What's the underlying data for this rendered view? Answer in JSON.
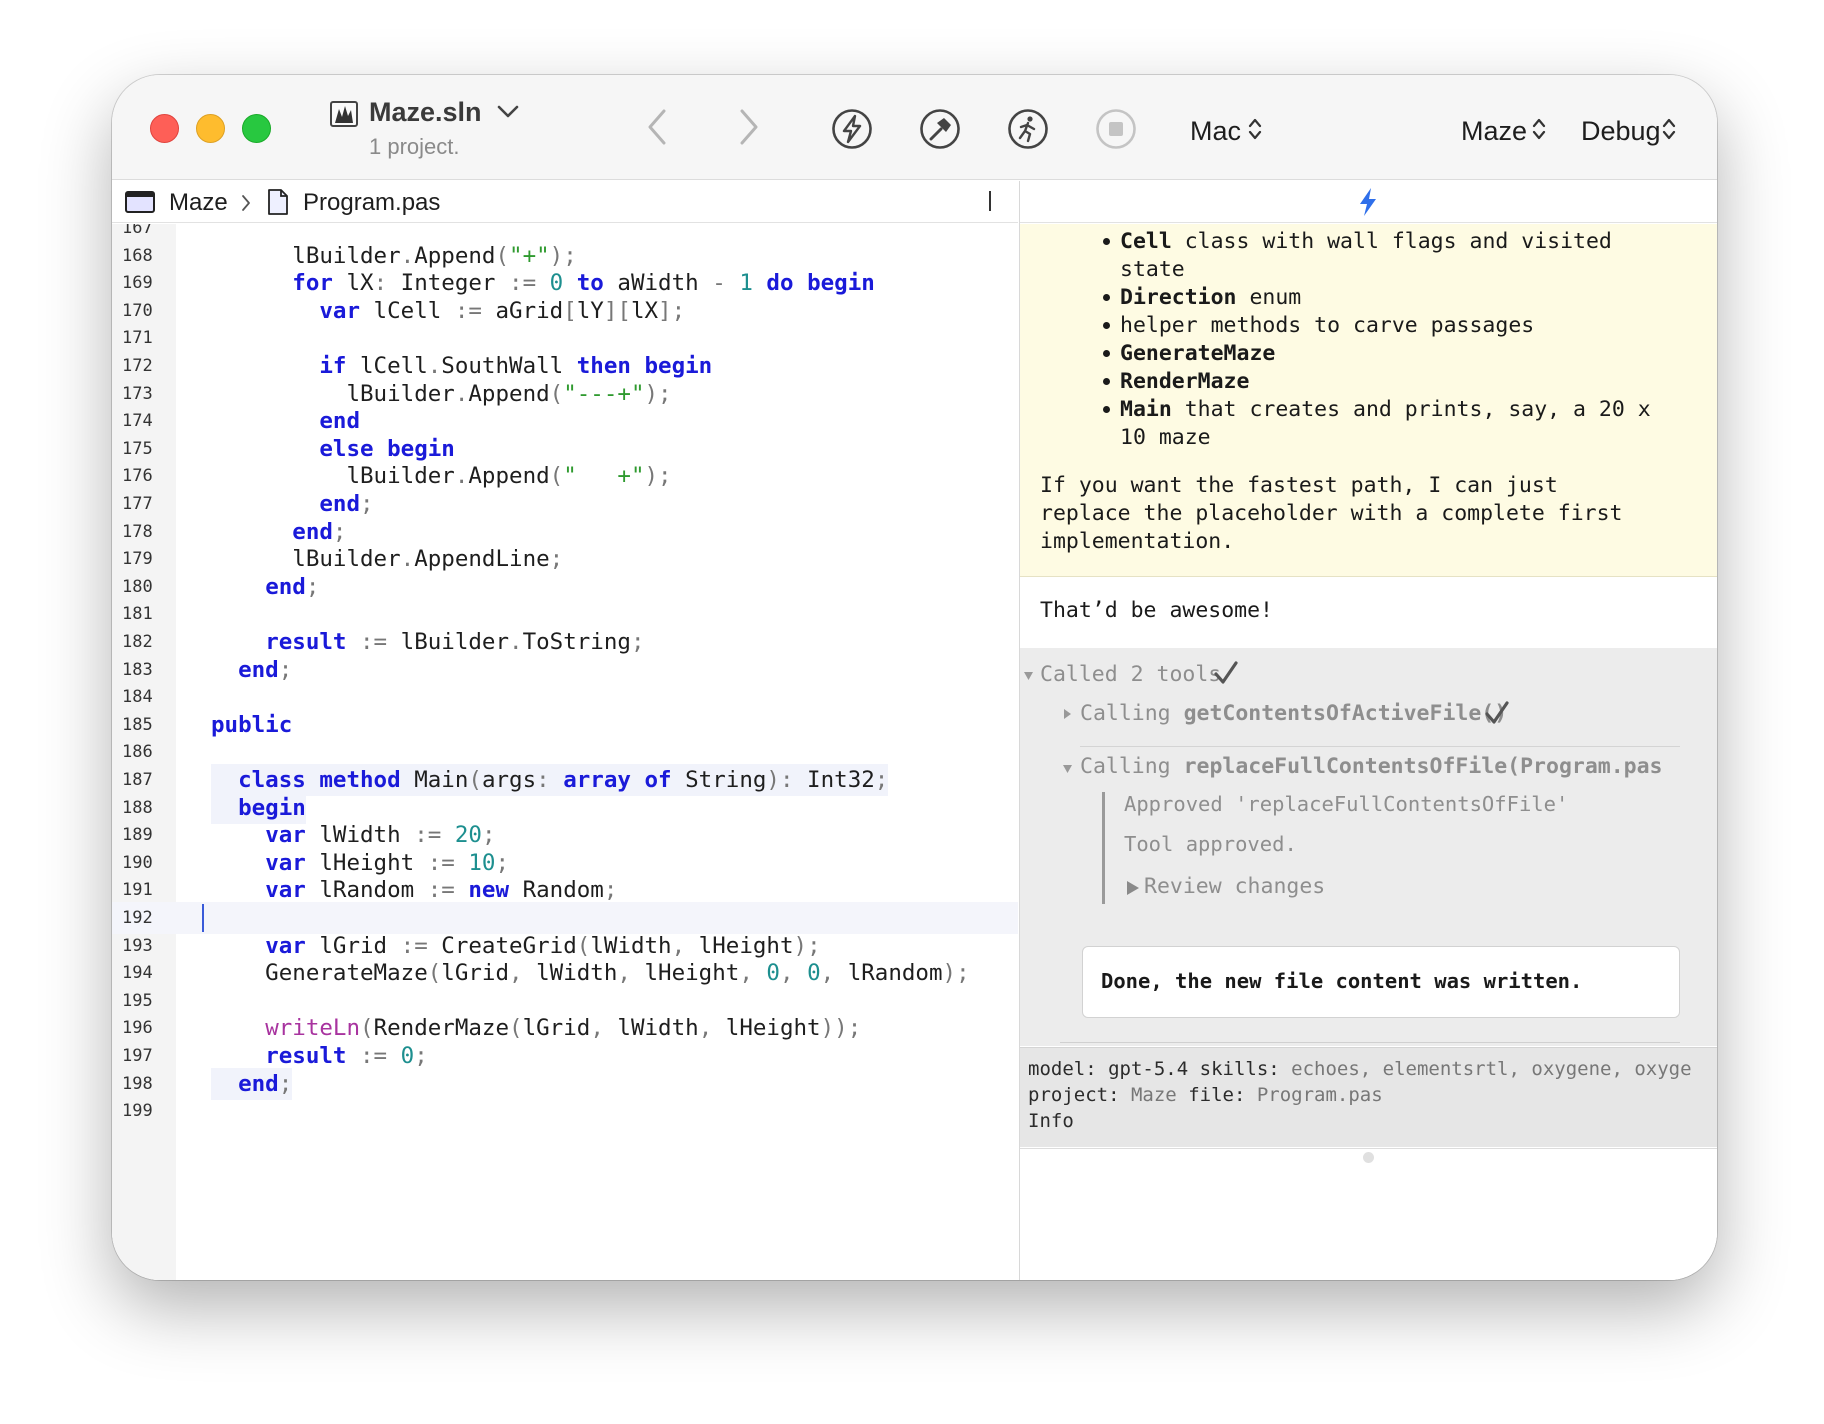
{
  "window": {
    "solution_title": "Maze.sln",
    "solution_subtitle": "1 project.",
    "platform": "Mac",
    "project": "Maze",
    "configuration": "Debug"
  },
  "icons": {
    "back": "chevron-left-icon",
    "forward": "chevron-right-icon",
    "ai": "lightning-circle-icon",
    "build": "hammer-circle-icon",
    "run": "running-figure-circle-icon",
    "stop": "stop-circle-icon"
  },
  "breadcrumb": {
    "project": "Maze",
    "file": "Program.pas"
  },
  "editor_lines": [
    {
      "n": "167",
      "code": ""
    },
    {
      "n": "168",
      "code": "      lBuilder.Append(\"+\");"
    },
    {
      "n": "169",
      "code": "      for lX: Integer := 0 to aWidth - 1 do begin"
    },
    {
      "n": "170",
      "code": "        var lCell := aGrid[lY][lX];"
    },
    {
      "n": "171",
      "code": ""
    },
    {
      "n": "172",
      "code": "        if lCell.SouthWall then begin"
    },
    {
      "n": "173",
      "code": "          lBuilder.Append(\"---+\");"
    },
    {
      "n": "174",
      "code": "        end"
    },
    {
      "n": "175",
      "code": "        else begin"
    },
    {
      "n": "176",
      "code": "          lBuilder.Append(\"   +\");"
    },
    {
      "n": "177",
      "code": "        end;"
    },
    {
      "n": "178",
      "code": "      end;"
    },
    {
      "n": "179",
      "code": "      lBuilder.AppendLine;"
    },
    {
      "n": "180",
      "code": "    end;"
    },
    {
      "n": "181",
      "code": ""
    },
    {
      "n": "182",
      "code": "    result := lBuilder.ToString;"
    },
    {
      "n": "183",
      "code": "  end;"
    },
    {
      "n": "184",
      "code": ""
    },
    {
      "n": "185",
      "code": "public"
    },
    {
      "n": "186",
      "code": ""
    },
    {
      "n": "187",
      "code": "  class method Main(args: array of String): Int32;"
    },
    {
      "n": "188",
      "code": "  begin"
    },
    {
      "n": "189",
      "code": "    var lWidth := 20;"
    },
    {
      "n": "190",
      "code": "    var lHeight := 10;"
    },
    {
      "n": "191",
      "code": "    var lRandom := new Random;"
    },
    {
      "n": "192",
      "code": ""
    },
    {
      "n": "193",
      "code": "    var lGrid := CreateGrid(lWidth, lHeight);"
    },
    {
      "n": "194",
      "code": "    GenerateMaze(lGrid, lWidth, lHeight, 0, 0, lRandom);"
    },
    {
      "n": "195",
      "code": ""
    },
    {
      "n": "196",
      "code": "    writeLn(RenderMaze(lGrid, lWidth, lHeight));"
    },
    {
      "n": "197",
      "code": "    result := 0;"
    },
    {
      "n": "198",
      "code": "  end;"
    },
    {
      "n": "199",
      "code": ""
    }
  ],
  "chat": {
    "bullets": [
      {
        "bold": "Cell",
        "text": " class with wall flags and visited",
        "cont": "state"
      },
      {
        "bold": "Direction",
        "text": " enum",
        "cont": ""
      },
      {
        "bold": "",
        "text": "helper methods to carve passages",
        "cont": ""
      },
      {
        "bold": "GenerateMaze",
        "text": "",
        "cont": ""
      },
      {
        "bold": "RenderMaze",
        "text": "",
        "cont": ""
      },
      {
        "bold": "Main",
        "text": " that creates and prints, say, a 20 x",
        "cont": "10 maze"
      }
    ],
    "paragraph": [
      "If you want the fastest path, I can just",
      "replace the placeholder with a complete first",
      "implementation."
    ],
    "user_message": "That’d be awesome!",
    "called_tools": "Called 2 tools",
    "calling_prefix": "Calling",
    "tool1": "getContentsOfActiveFile()",
    "tool2": "replaceFullContentsOfFile(Program.pas",
    "approved": "Approved 'replaceFullContentsOfFile'",
    "tool_approved": "Tool approved.",
    "review_changes": "Review changes",
    "done_message": "Done, the new file content was written."
  },
  "status": {
    "model_label": "model:",
    "model": "gpt-5.4",
    "skills_label": "skills:",
    "skills": "echoes, elementsrtl, oxygene, oxyge",
    "project_label": "project:",
    "project": "Maze",
    "file_label": "file:",
    "file": "Program.pas",
    "info": "Info"
  }
}
